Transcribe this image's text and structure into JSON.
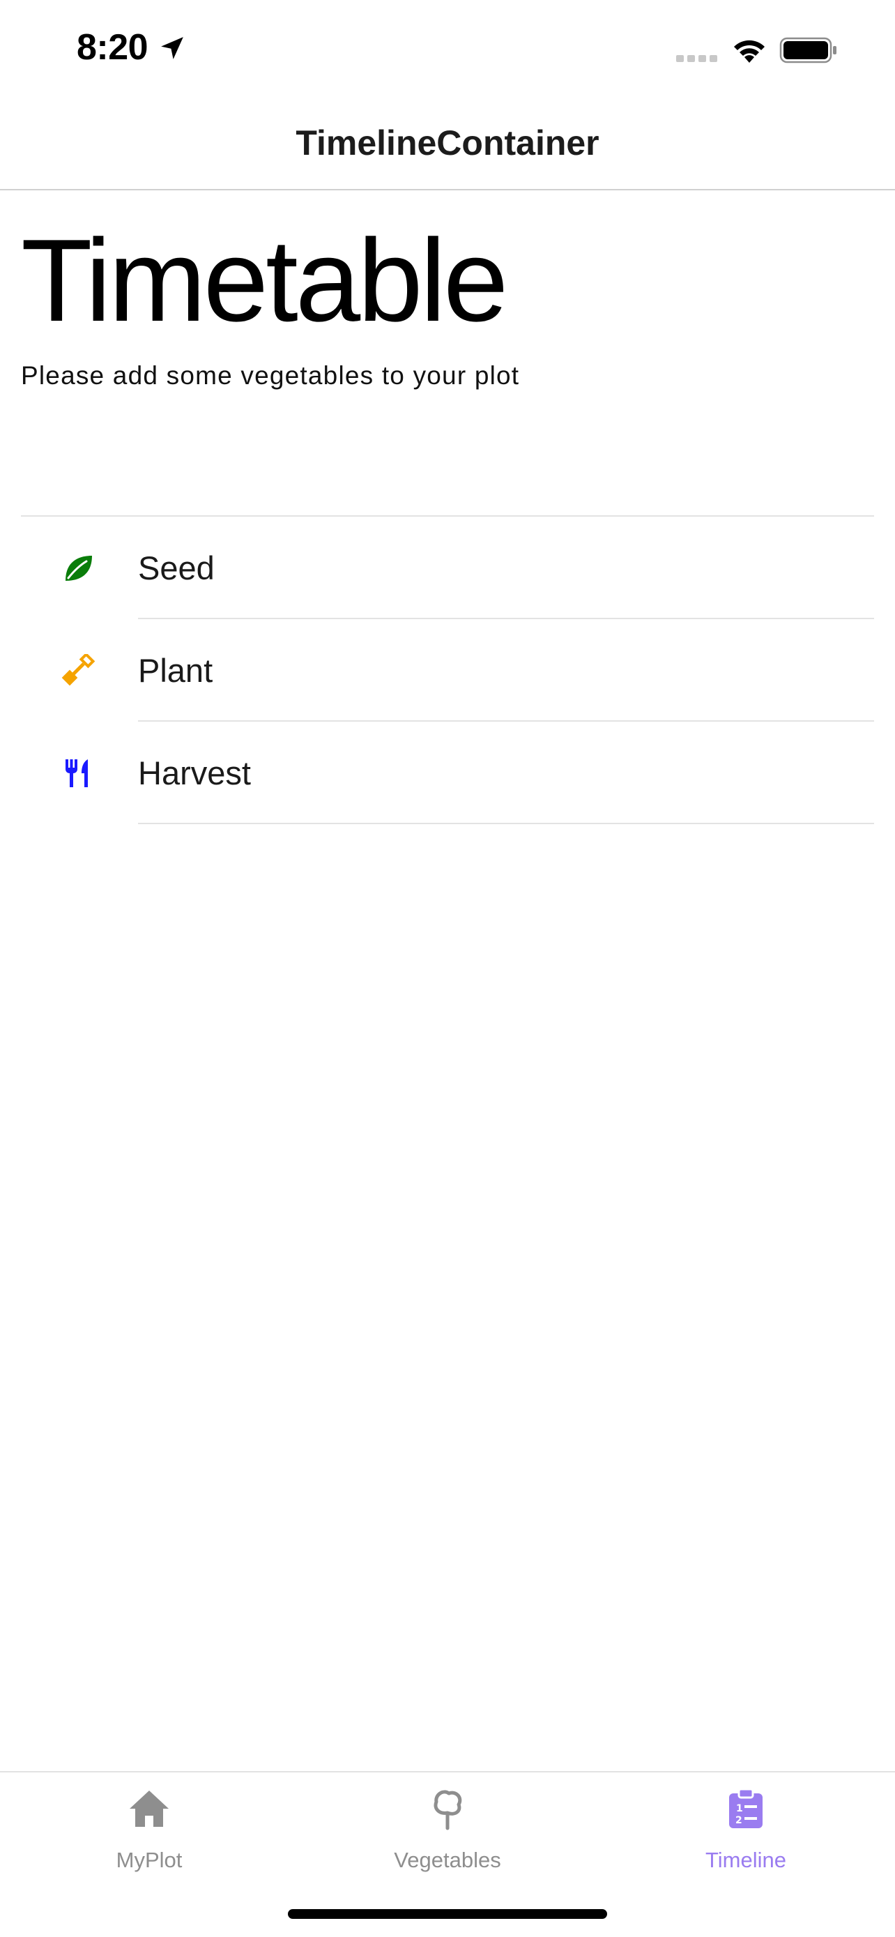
{
  "status_bar": {
    "time": "8:20",
    "icons": [
      "location-arrow-icon",
      "cellular-signal-icon",
      "wifi-icon",
      "battery-icon"
    ]
  },
  "nav": {
    "title": "TimelineContainer"
  },
  "main": {
    "title": "Timetable",
    "subtitle": "Please add some vegetables to your plot"
  },
  "legend": {
    "items": [
      {
        "label": "Seed",
        "icon": "leaf-icon",
        "color": "#0a7d0a"
      },
      {
        "label": "Plant",
        "icon": "shovel-icon",
        "color": "#f5a300"
      },
      {
        "label": "Harvest",
        "icon": "utensils-icon",
        "color": "#1a1aff"
      }
    ]
  },
  "tab_bar": {
    "tabs": [
      {
        "label": "MyPlot",
        "icon": "home-icon",
        "active": false
      },
      {
        "label": "Vegetables",
        "icon": "tree-icon",
        "active": false
      },
      {
        "label": "Timeline",
        "icon": "clipboard-list-icon",
        "active": true
      }
    ],
    "active_color": "#9a7cf0",
    "inactive_color": "#8e8e8e"
  }
}
